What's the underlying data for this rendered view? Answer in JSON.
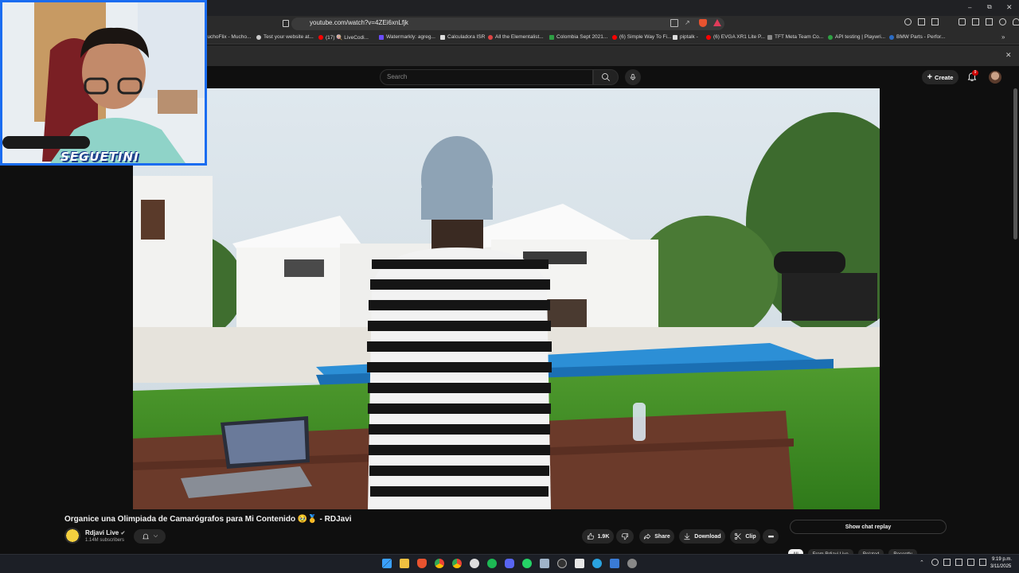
{
  "browser": {
    "url": "youtube.com/watch?v=4ZEi6xnLfjk",
    "bookmarks": [
      {
        "label": "luchoFlix - Mucho..."
      },
      {
        "label": "Test your website at..."
      },
      {
        "label": "(17) 🍭 LiveCodi..."
      },
      {
        "label": "Watermarkly: agreg..."
      },
      {
        "label": "Calculadora ISR"
      },
      {
        "label": "All the Elementalist..."
      },
      {
        "label": "Colombia Sept 2021..."
      },
      {
        "label": "(6) Simple Way To Fi..."
      },
      {
        "label": "piptalk -"
      },
      {
        "label": "(6) EVGA XR1 Lite P..."
      },
      {
        "label": "TFT Meta Team Co..."
      },
      {
        "label": "API testing | Playwri..."
      },
      {
        "label": "BMW Parts - Perfor..."
      }
    ]
  },
  "header": {
    "search_placeholder": "Search",
    "create_label": "Create",
    "notification_count": "9"
  },
  "webcam": {
    "overlay_text": "SEGUETINI"
  },
  "video": {
    "title": "Organice una Olimpiada de Camarógrafos para Mi Contenido 🥹🥇 - RDJavi",
    "channel": "Rdjavi Live",
    "subscribers": "1.14M subscribers",
    "likes": "1.9K",
    "share_label": "Share",
    "download_label": "Download",
    "clip_label": "Clip"
  },
  "sidebar": {
    "chat_replay_label": "Show chat replay",
    "chips": [
      "All",
      "From Rdjavi Live",
      "Related",
      "Recently"
    ]
  },
  "taskbar": {
    "time": "9:19 p.m.",
    "date": "3/11/2025"
  },
  "colors": {
    "accent": "#1a6cf0",
    "brand_red": "#cc0000",
    "background": "#0f0f0f"
  }
}
